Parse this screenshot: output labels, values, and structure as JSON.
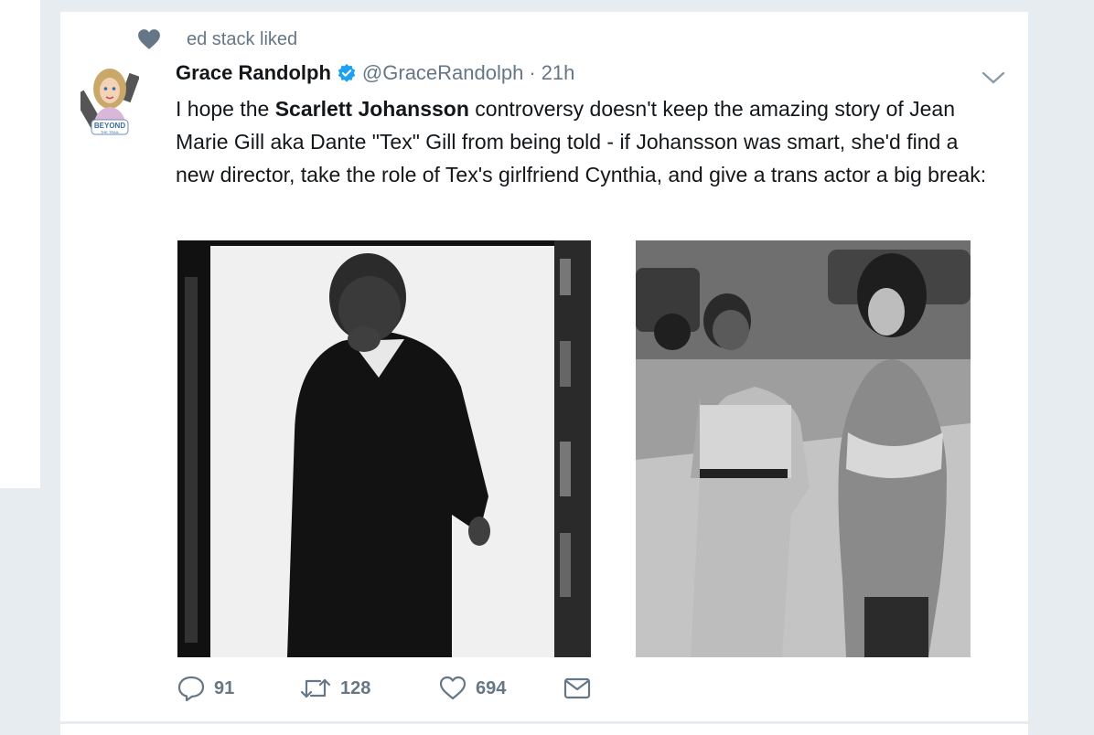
{
  "context": {
    "text": "ed stack liked",
    "icon": "heart-icon"
  },
  "tweet": {
    "author_name": "Grace Randolph",
    "verified": true,
    "handle": "@GraceRandolph",
    "separator": "·",
    "time": "21h",
    "text_parts": {
      "before": "I hope the ",
      "bold": "Scarlett Johansson",
      "after": " controversy doesn't keep the amazing story of Jean Marie Gill aka Dante \"Tex\" Gill from being told - if Johansson was smart, she'd find a new director, take the role of Tex's girlfriend Cynthia, and give a trans actor a big break:"
    },
    "avatar_badge": "BEYOND",
    "avatar_sub": "THE TRAIL"
  },
  "actions": {
    "replies": "91",
    "retweets": "128",
    "likes": "694"
  },
  "colors": {
    "verified": "#1da1f2",
    "muted": "#657786",
    "background": "#e6ecf0"
  }
}
